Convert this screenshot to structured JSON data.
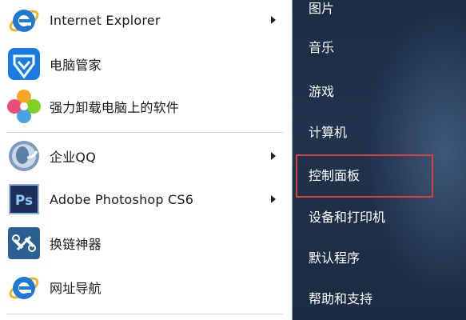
{
  "left_items": [
    {
      "label": "Internet Explorer",
      "icon": "internet-explorer-icon",
      "has_arrow": true
    },
    {
      "label": "电脑管家",
      "icon": "pc-manager-icon",
      "has_arrow": false
    },
    {
      "label": "强力卸载电脑上的软件",
      "icon": "uninstaller-icon",
      "has_arrow": false
    },
    {
      "label": "企业QQ",
      "icon": "enterprise-qq-icon",
      "has_arrow": true
    },
    {
      "label": "Adobe Photoshop CS6",
      "icon": "photoshop-icon",
      "has_arrow": true
    },
    {
      "label": "换链神器",
      "icon": "link-tool-icon",
      "has_arrow": false
    },
    {
      "label": "网址导航",
      "icon": "web-navigation-icon",
      "has_arrow": false
    }
  ],
  "photoshop_icon_text": "Ps",
  "right_items": [
    "图片",
    "音乐",
    "游戏",
    "计算机",
    "控制面板",
    "设备和打印机",
    "默认程序",
    "帮助和支持"
  ],
  "highlighted_item": "控制面板",
  "colors": {
    "highlight_border": "#d8413a",
    "right_panel": "#1e2f48",
    "ie_blue": "#1f78d1"
  }
}
